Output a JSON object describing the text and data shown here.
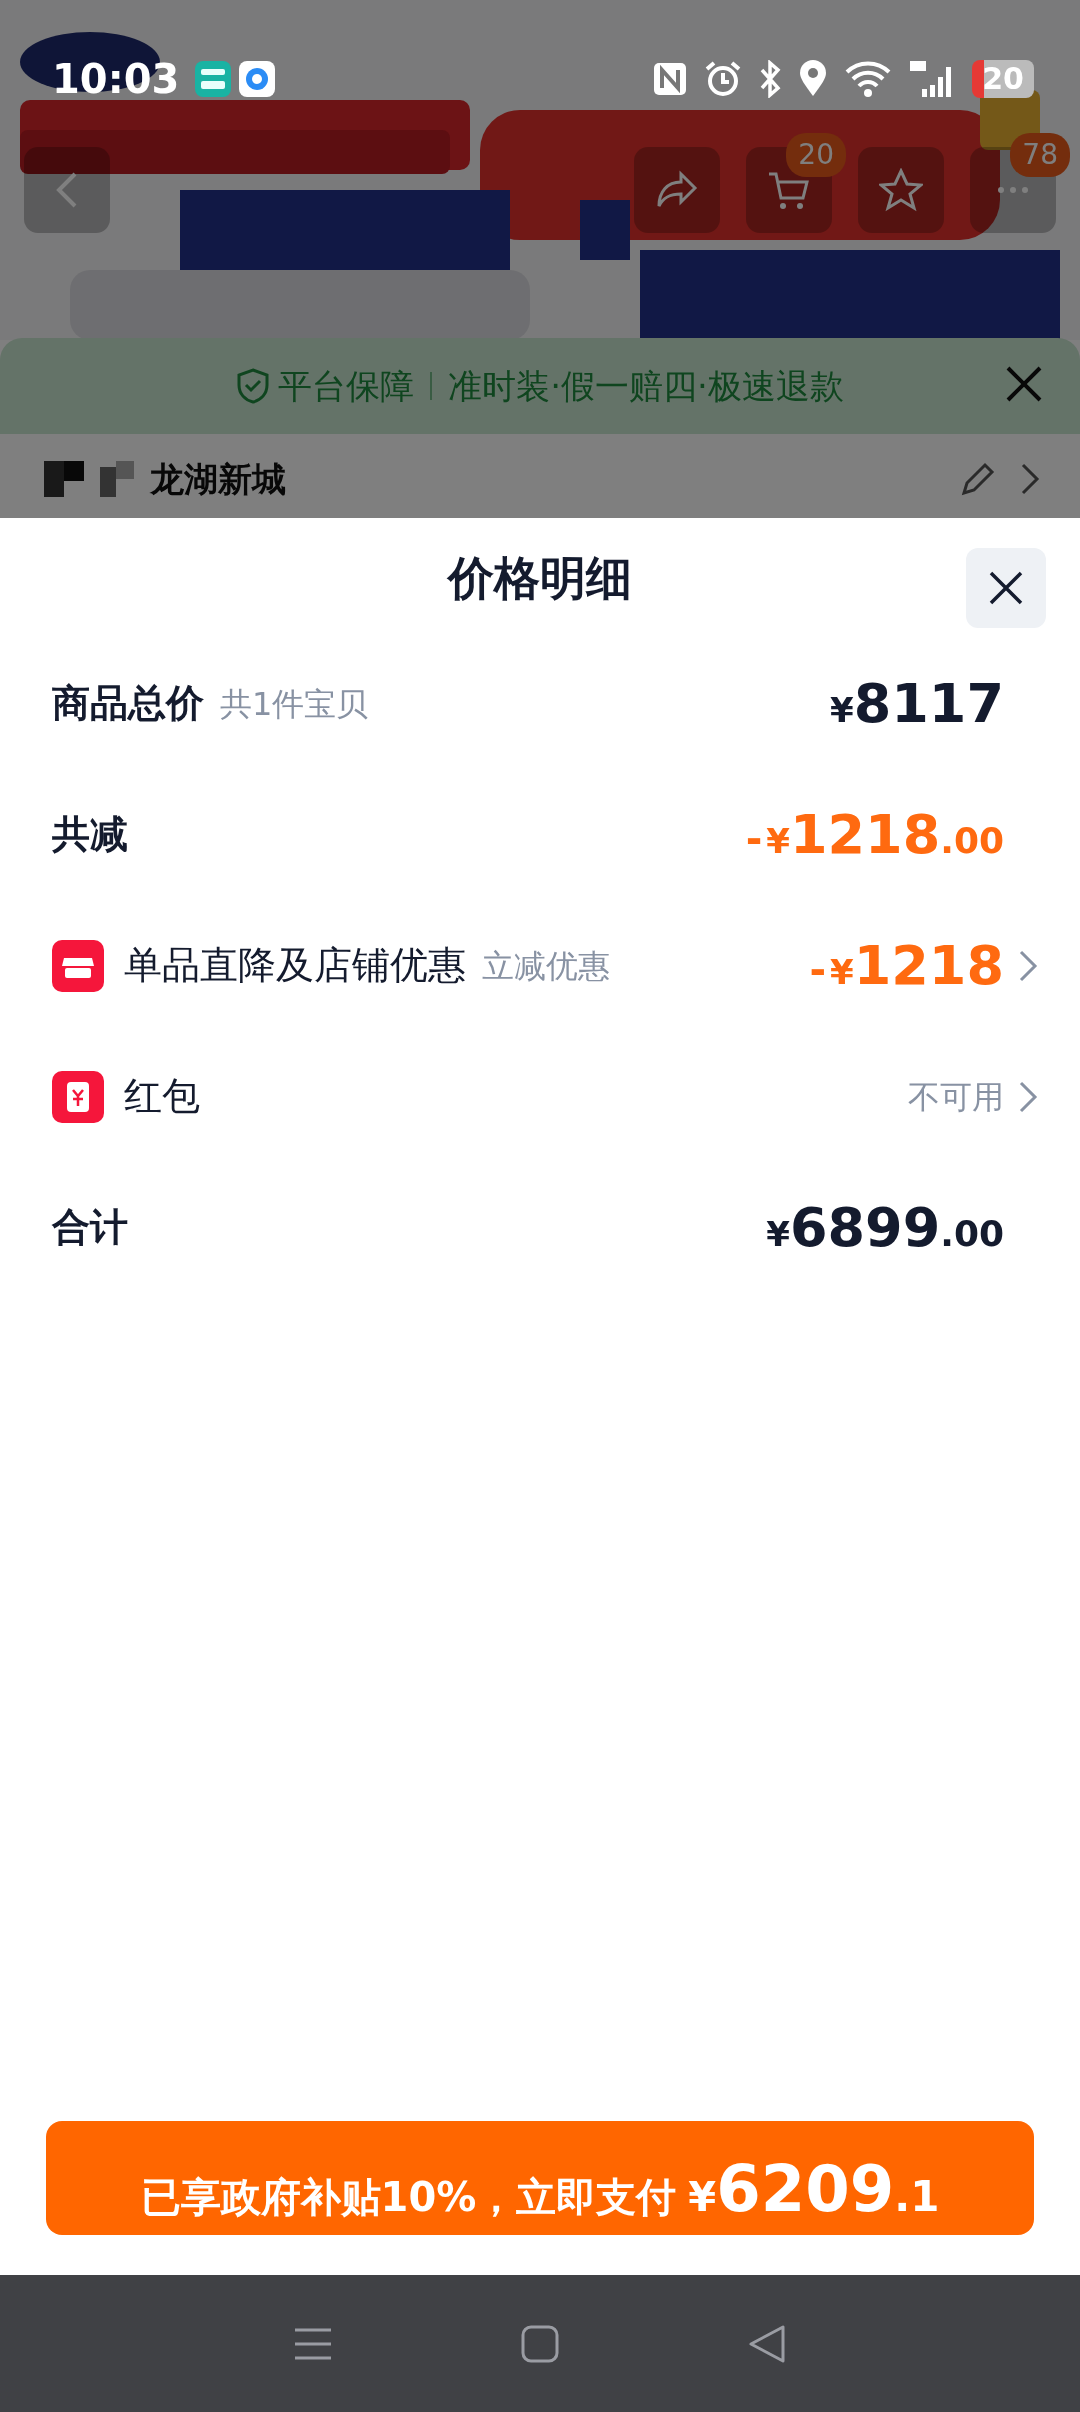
{
  "status_bar": {
    "time": "10:03",
    "battery": "20"
  },
  "nav": {
    "cart_badge": "20",
    "more_badge": "78"
  },
  "guarantee": {
    "title": "平台保障",
    "text": "准时装·假一赔四·极速退款"
  },
  "address": {
    "text": "龙湖新城"
  },
  "sheet": {
    "title": "价格明细",
    "rows": [
      {
        "kind": "total",
        "label": "商品总价",
        "note": "共1件宝贝",
        "amount": {
          "currency": "¥",
          "integer": "8117"
        },
        "highlight": false
      },
      {
        "kind": "total",
        "label": "共减",
        "amount": {
          "sign": "-",
          "currency": "¥",
          "integer": "1218",
          "decimal": ".00"
        },
        "highlight": true
      },
      {
        "kind": "shop",
        "label": "单品直降及店铺优惠",
        "note": "立减优惠",
        "amount": {
          "sign": "-",
          "currency": "¥",
          "integer": "1218"
        },
        "highlight": true
      },
      {
        "kind": "packet",
        "label": "红包",
        "status": "不可用"
      },
      {
        "kind": "total",
        "label": "合计",
        "amount": {
          "currency": "¥",
          "integer": "6899",
          "decimal": ".00"
        },
        "highlight": false
      }
    ]
  },
  "pay_button": {
    "text": "已享政府补贴10%，立即支付",
    "currency": "¥",
    "integer": "6209",
    "decimal": ".1"
  }
}
